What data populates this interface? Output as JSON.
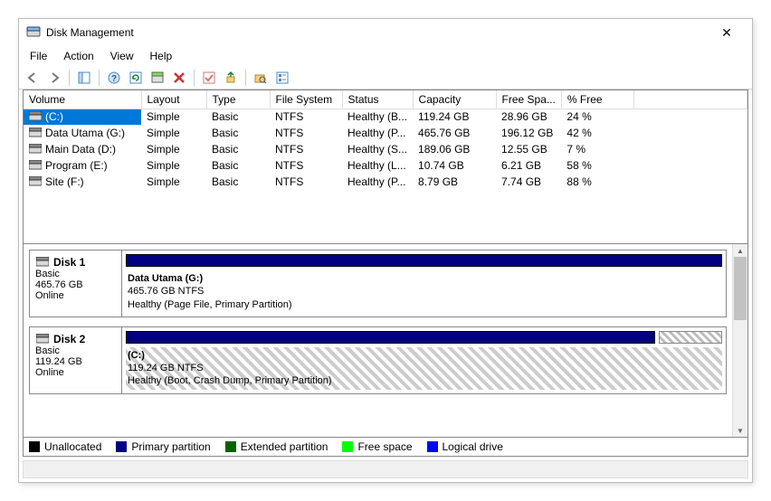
{
  "window": {
    "title": "Disk Management"
  },
  "menu": {
    "file": "File",
    "action": "Action",
    "view": "View",
    "help": "Help"
  },
  "columns": {
    "volume": "Volume",
    "layout": "Layout",
    "type": "Type",
    "fs": "File System",
    "status": "Status",
    "capacity": "Capacity",
    "free": "Free Spa...",
    "pct": "% Free"
  },
  "volumes": [
    {
      "name": "(C:)",
      "layout": "Simple",
      "type": "Basic",
      "fs": "NTFS",
      "status": "Healthy (B...",
      "capacity": "119.24 GB",
      "free": "28.96 GB",
      "pct": "24 %",
      "selected": true
    },
    {
      "name": "Data Utama (G:)",
      "layout": "Simple",
      "type": "Basic",
      "fs": "NTFS",
      "status": "Healthy (P...",
      "capacity": "465.76 GB",
      "free": "196.12 GB",
      "pct": "42 %"
    },
    {
      "name": "Main Data (D:)",
      "layout": "Simple",
      "type": "Basic",
      "fs": "NTFS",
      "status": "Healthy (S...",
      "capacity": "189.06 GB",
      "free": "12.55 GB",
      "pct": "7 %"
    },
    {
      "name": "Program (E:)",
      "layout": "Simple",
      "type": "Basic",
      "fs": "NTFS",
      "status": "Healthy (L...",
      "capacity": "10.74 GB",
      "free": "6.21 GB",
      "pct": "58 %"
    },
    {
      "name": "Site (F:)",
      "layout": "Simple",
      "type": "Basic",
      "fs": "NTFS",
      "status": "Healthy (P...",
      "capacity": "8.79 GB",
      "free": "7.74 GB",
      "pct": "88 %"
    }
  ],
  "disks": [
    {
      "title": "Disk 1",
      "type": "Basic",
      "size": "465.76 GB",
      "state": "Online",
      "partition": {
        "name": "Data Utama  (G:)",
        "size": "465.76 GB NTFS",
        "status": "Healthy (Page File, Primary Partition)"
      },
      "has_unallocated": false
    },
    {
      "title": "Disk 2",
      "type": "Basic",
      "size": "119.24 GB",
      "state": "Online",
      "partition": {
        "name": "(C:)",
        "size": "119.24 GB NTFS",
        "status": "Healthy (Boot, Crash Dump, Primary Partition)"
      },
      "has_unallocated": true
    }
  ],
  "legend": {
    "unallocated": "Unallocated",
    "primary": "Primary partition",
    "extended": "Extended partition",
    "free": "Free space",
    "logical": "Logical drive",
    "colors": {
      "unallocated": "#000000",
      "primary": "#000080",
      "extended": "#006400",
      "free": "#00ff00",
      "logical": "#0000ff"
    }
  }
}
